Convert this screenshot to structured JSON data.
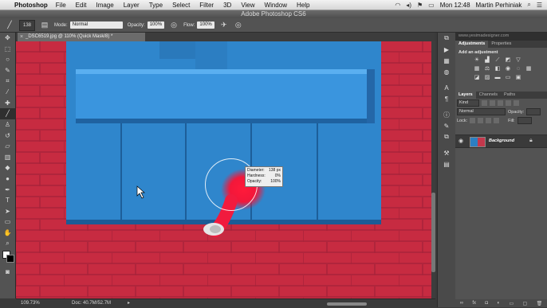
{
  "menubar": {
    "apple": "",
    "app": "Photoshop",
    "items": [
      "File",
      "Edit",
      "Image",
      "Layer",
      "Type",
      "Select",
      "Filter",
      "3D",
      "View",
      "Window",
      "Help"
    ],
    "clock": "Mon 12:48",
    "user": "Martin Perhiniak"
  },
  "window": {
    "title": "Adobe Photoshop CS6"
  },
  "options": {
    "brush_size": "138",
    "mode_label": "Mode:",
    "mode_value": "Normal",
    "opacity_label": "Opacity:",
    "opacity_value": "100%",
    "flow_label": "Flow:",
    "flow_value": "100%"
  },
  "document": {
    "tab_title": "_DSC6519.jpg @ 110% (Quick Mask/8) *",
    "close": "×"
  },
  "brush_hud": {
    "diameter_label": "Diameter:",
    "diameter_value": "138 px",
    "hardness_label": "Hardness:",
    "hardness_value": "0%",
    "opacity_label": "Opacity:",
    "opacity_value": "100%"
  },
  "status": {
    "zoom": "109.73%",
    "doc": "Doc: 40.7M/52.7M"
  },
  "adjustments_panel": {
    "tabs": [
      "Adjustments",
      "Properties"
    ],
    "heading": "Add an adjustment"
  },
  "layers_panel": {
    "tabs": [
      "Layers",
      "Channels",
      "Paths"
    ],
    "kind_label": "Kind",
    "blend_mode": "Normal",
    "opacity_label": "Opacity:",
    "lock_label": "Lock:",
    "fill_label": "Fill:",
    "layers": [
      {
        "name": "Background"
      }
    ]
  },
  "watermark": "www.yesimadesigner.com",
  "colors": {
    "quick_mask_red": "#c22a3f",
    "shutter_blue": "#2f86cc",
    "photoshop_panel": "#535353"
  }
}
